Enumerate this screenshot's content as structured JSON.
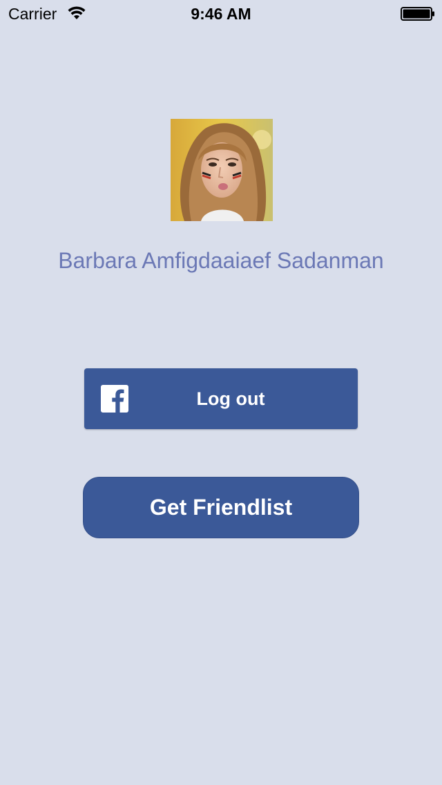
{
  "status_bar": {
    "carrier": "Carrier",
    "time": "9:46 AM",
    "wifi_icon": "wifi-icon",
    "battery_icon": "battery-icon"
  },
  "profile": {
    "avatar_icon": "profile-photo",
    "name": "Barbara Amfigdaaiaef Sadanman"
  },
  "login_button": {
    "icon": "facebook-icon",
    "label": "Log out"
  },
  "friendlist_button": {
    "label": "Get Friendlist"
  },
  "colors": {
    "background": "#d9deeb",
    "facebook_blue": "#3b5998",
    "name_text": "#6b78b5"
  }
}
